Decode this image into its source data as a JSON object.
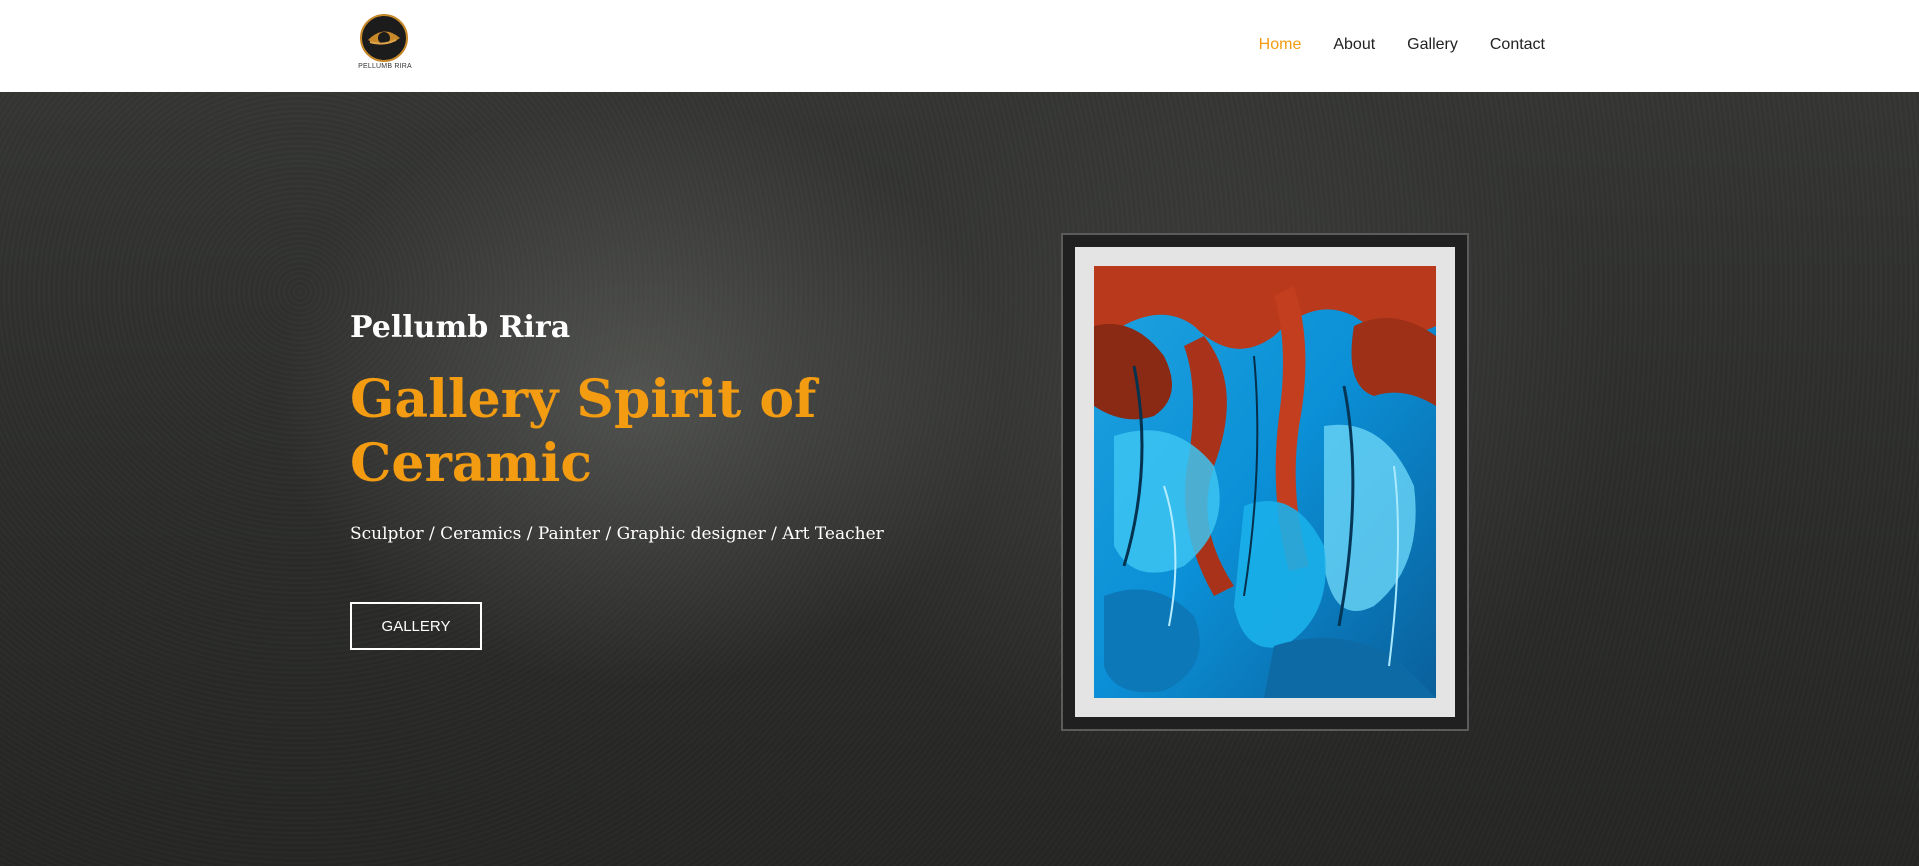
{
  "logo": {
    "text": "PELLUMB RIRA"
  },
  "nav": {
    "items": [
      {
        "label": "Home",
        "active": true
      },
      {
        "label": "About",
        "active": false
      },
      {
        "label": "Gallery",
        "active": false
      },
      {
        "label": "Contact",
        "active": false
      }
    ]
  },
  "hero": {
    "subtitle": "Pellumb Rira",
    "title": "Gallery Spirit of Ceramic",
    "roles": "Sculptor / Ceramics / Painter / Graphic designer / Art Teacher",
    "button_label": "GALLERY"
  },
  "colors": {
    "accent": "#f39c12",
    "header_bg": "#ffffff",
    "hero_bg": "#2b2c2a"
  }
}
